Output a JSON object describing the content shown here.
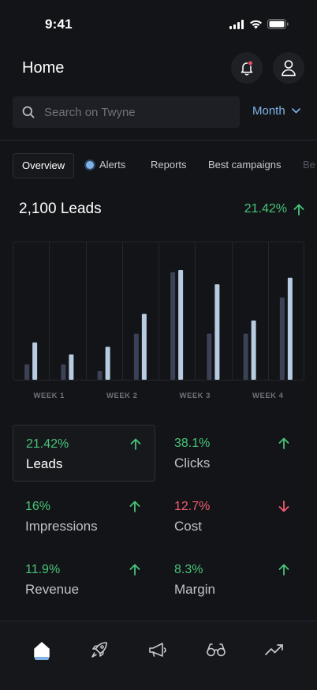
{
  "status_bar": {
    "time": "9:41"
  },
  "header": {
    "title": "Home"
  },
  "search": {
    "placeholder": "Search on Twyne"
  },
  "period": {
    "label": "Month"
  },
  "tabs": [
    {
      "label": "Overview",
      "active": true
    },
    {
      "label": "Alerts"
    },
    {
      "label": "Reports"
    },
    {
      "label": "Best campaigns"
    },
    {
      "label": "Be"
    }
  ],
  "summary": {
    "title": "2,100 Leads",
    "change": "21.42%",
    "trend": "up"
  },
  "chart_data": {
    "type": "bar",
    "categories": [
      "WEEK 1",
      "WEEK 2",
      "WEEK 3",
      "WEEK 4"
    ],
    "ylim": [
      0,
      100
    ],
    "series": [
      {
        "values": [
          14,
          14,
          8,
          42,
          98,
          42,
          42,
          75
        ]
      },
      {
        "values": [
          34,
          23,
          30,
          60,
          100,
          87,
          54,
          93
        ]
      }
    ],
    "colors": [
      "#3b4255",
      "#b7cbe1"
    ]
  },
  "metrics": [
    {
      "value": "21.42%",
      "label": "Leads",
      "trend": "up",
      "selected": true
    },
    {
      "value": "38.1%",
      "label": "Clicks",
      "trend": "up"
    },
    {
      "value": "16%",
      "label": "Impressions",
      "trend": "up"
    },
    {
      "value": "12.7%",
      "label": "Cost",
      "trend": "down"
    },
    {
      "value": "11.9%",
      "label": "Revenue",
      "trend": "up"
    },
    {
      "value": "8.3%",
      "label": "Margin",
      "trend": "up"
    }
  ],
  "colors": {
    "background": "#131418",
    "accent": "#7fb2e5",
    "positive": "#47c478",
    "negative": "#ef5a70"
  },
  "bottom_nav": [
    {
      "icon": "home-icon",
      "active": true
    },
    {
      "icon": "rocket-icon"
    },
    {
      "icon": "megaphone-icon"
    },
    {
      "icon": "glasses-icon"
    },
    {
      "icon": "trending-up-icon"
    }
  ]
}
